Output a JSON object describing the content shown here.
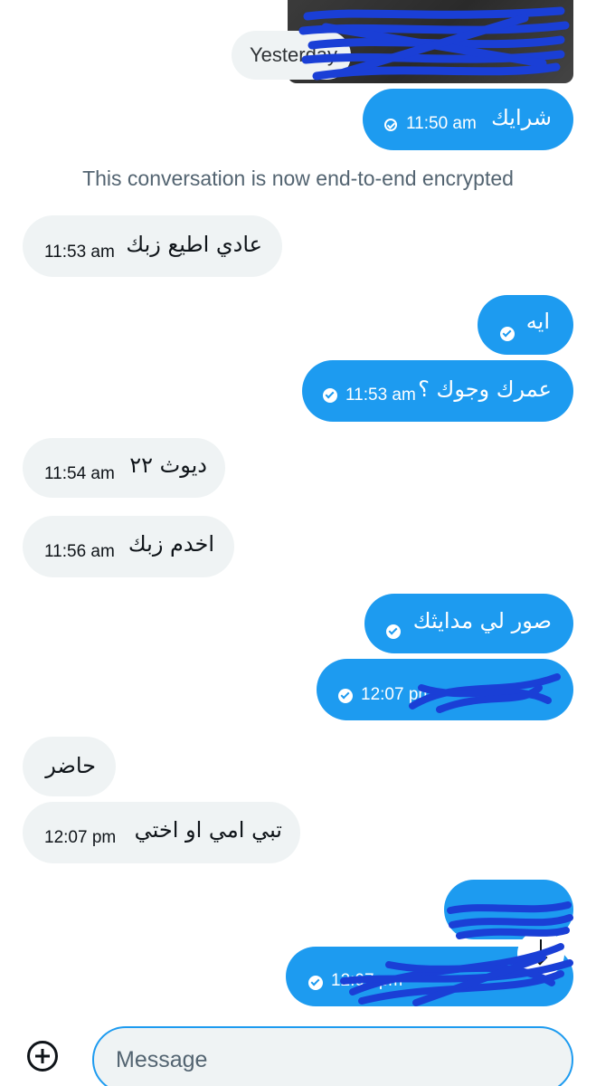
{
  "date_separator": "Yesterday",
  "encryption_notice": "This conversation is now end-to-end encrypted",
  "messages": [
    {
      "text": "شرايك",
      "time": "11:50 am",
      "dir": "out"
    },
    {
      "text": "عادي اطيع زبك",
      "time": "11:53 am",
      "dir": "in"
    },
    {
      "text": "ايه",
      "time": "",
      "dir": "out"
    },
    {
      "text": "عمرك وجوك ؟",
      "time": "11:53 am",
      "dir": "out"
    },
    {
      "text": "ديوث ٢٢",
      "time": "11:54 am",
      "dir": "in"
    },
    {
      "text": "اخدم زبك",
      "time": "11:56 am",
      "dir": "in"
    },
    {
      "text": "صور لي مدايثك",
      "time": "",
      "dir": "out"
    },
    {
      "text": "",
      "time": "12:07 pm",
      "dir": "out"
    },
    {
      "text": "حاضر",
      "time": "",
      "dir": "in"
    },
    {
      "text": "تبي امي او اختي",
      "time": "12:07 pm",
      "dir": "in"
    },
    {
      "text": "",
      "time": "",
      "dir": "out"
    },
    {
      "text": "",
      "time": "12:07 pm",
      "dir": "out"
    }
  ],
  "composer": {
    "placeholder": "Message"
  },
  "colors": {
    "outgoing_bubble": "#1d9bf0",
    "incoming_bubble": "#eff3f4",
    "redaction_scribble": "#1a3fd6"
  },
  "icons": [
    "read-check-icon",
    "sent-check-icon",
    "add-media-icon",
    "download-icon"
  ]
}
